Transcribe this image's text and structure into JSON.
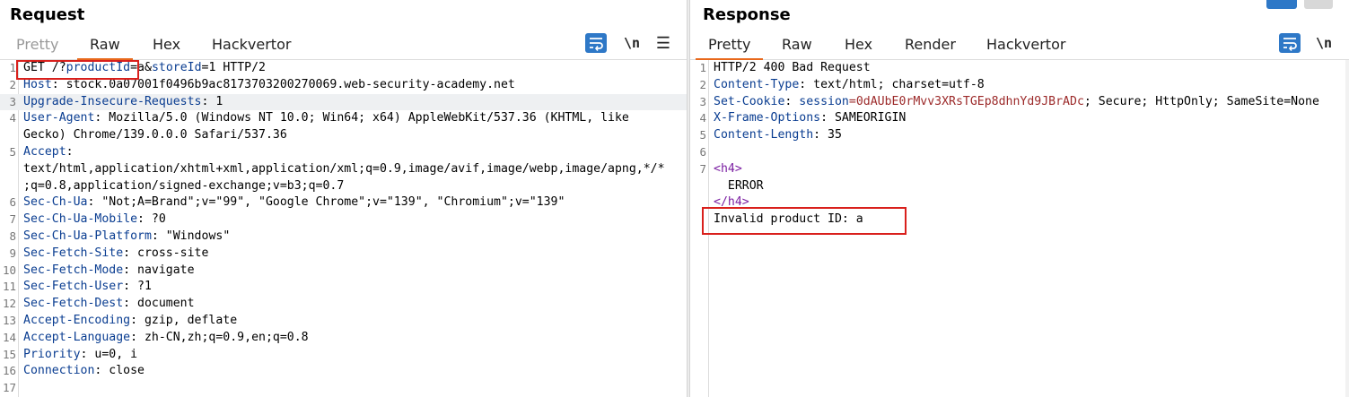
{
  "request": {
    "title": "Request",
    "tabs": [
      "Pretty",
      "Raw",
      "Hex",
      "Hackvertor"
    ],
    "active_tab": "Raw",
    "toolbar": {
      "wrap_icon": "text-wrap-icon",
      "newline_label": "\\n",
      "menu_label": "☰"
    },
    "lines": [
      {
        "n": "1",
        "k": "GET /?",
        "pk": "productId",
        "eq": "=a&",
        "pk2": "storeId",
        "rest": "=1 HTTP/2"
      },
      {
        "n": "2",
        "k": "Host",
        "v": ": stock.0a07001f0496b9ac8173703200270069.web-security-academy.net"
      },
      {
        "n": "3",
        "k": "Upgrade-Insecure-Requests",
        "v": ": 1"
      },
      {
        "n": "4",
        "k": "User-Agent",
        "v": ": Mozilla/5.0 (Windows NT 10.0; Win64; x64) AppleWebKit/537.36 (KHTML, like"
      },
      {
        "n": "",
        "k": "",
        "v": "Gecko) Chrome/139.0.0.0 Safari/537.36"
      },
      {
        "n": "5",
        "k": "Accept",
        "v": ":"
      },
      {
        "n": "",
        "k": "",
        "v": "text/html,application/xhtml+xml,application/xml;q=0.9,image/avif,image/webp,image/apng,*/*"
      },
      {
        "n": "",
        "k": "",
        "v": ";q=0.8,application/signed-exchange;v=b3;q=0.7"
      },
      {
        "n": "6",
        "k": "Sec-Ch-Ua",
        "v": ": \"Not;A=Brand\";v=\"99\", \"Google Chrome\";v=\"139\", \"Chromium\";v=\"139\""
      },
      {
        "n": "7",
        "k": "Sec-Ch-Ua-Mobile",
        "v": ": ?0"
      },
      {
        "n": "8",
        "k": "Sec-Ch-Ua-Platform",
        "v": ": \"Windows\""
      },
      {
        "n": "9",
        "k": "Sec-Fetch-Site",
        "v": ": cross-site"
      },
      {
        "n": "10",
        "k": "Sec-Fetch-Mode",
        "v": ": navigate"
      },
      {
        "n": "11",
        "k": "Sec-Fetch-User",
        "v": ": ?1"
      },
      {
        "n": "12",
        "k": "Sec-Fetch-Dest",
        "v": ": document"
      },
      {
        "n": "13",
        "k": "Accept-Encoding",
        "v": ": gzip, deflate"
      },
      {
        "n": "14",
        "k": "Accept-Language",
        "v": ": zh-CN,zh;q=0.9,en;q=0.8"
      },
      {
        "n": "15",
        "k": "Priority",
        "v": ": u=0, i"
      },
      {
        "n": "16",
        "k": "Connection",
        "v": ": close"
      },
      {
        "n": "17",
        "k": "",
        "v": ""
      }
    ]
  },
  "response": {
    "title": "Response",
    "tabs": [
      "Pretty",
      "Raw",
      "Hex",
      "Render",
      "Hackvertor"
    ],
    "active_tab": "Pretty",
    "toolbar": {
      "wrap_icon": "text-wrap-icon",
      "newline_label": "\\n"
    },
    "lines": [
      {
        "n": "1",
        "k": "",
        "v": "HTTP/2 400 Bad Request"
      },
      {
        "n": "2",
        "k": "Content-Type",
        "v": ": text/html; charset=utf-8"
      },
      {
        "n": "3",
        "k": "Set-Cookie",
        "v": ": ",
        "ck": "session",
        "cv": "=0dAUbE0rMvv3XRsTGEp8dhnYd9JBrADc",
        "rest": "; Secure; HttpOnly; SameSite=None"
      },
      {
        "n": "4",
        "k": "X-Frame-Options",
        "v": ": SAMEORIGIN"
      },
      {
        "n": "5",
        "k": "Content-Length",
        "v": ": 35"
      },
      {
        "n": "6",
        "k": "",
        "v": ""
      },
      {
        "n": "7",
        "tag": "<h4>"
      },
      {
        "n": "",
        "k": "",
        "v": "  ERROR"
      },
      {
        "n": "",
        "tag": "</h4>"
      },
      {
        "n": "",
        "k": "",
        "v": "Invalid product ID: a"
      }
    ]
  },
  "colors": {
    "highlight_box": "#d9201c",
    "active_tab_underline": "#e8681b",
    "header_key": "#0a3d91",
    "wrap_button": "#2e78c7"
  }
}
